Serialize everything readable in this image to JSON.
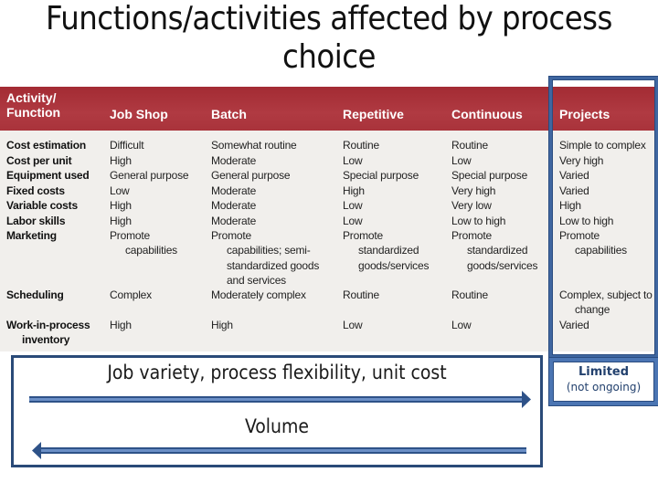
{
  "title": "Functions/activities affected by process choice",
  "table": {
    "headers": [
      "Activity/\nFunction",
      "Job Shop",
      "Batch",
      "Repetitive",
      "Continuous",
      "Projects"
    ],
    "rows": [
      {
        "label": "Cost estimation",
        "values": [
          "Difficult",
          "Somewhat routine",
          "Routine",
          "Routine",
          "Simple to complex"
        ]
      },
      {
        "label": "Cost per unit",
        "values": [
          "High",
          "Moderate",
          "Low",
          "Low",
          "Very high"
        ]
      },
      {
        "label": "Equipment used",
        "values": [
          "General purpose",
          "General purpose",
          "Special purpose",
          "Special purpose",
          "Varied"
        ]
      },
      {
        "label": "Fixed costs",
        "values": [
          "Low",
          "Moderate",
          "High",
          "Very high",
          "Varied"
        ]
      },
      {
        "label": "Variable costs",
        "values": [
          "High",
          "Moderate",
          "Low",
          "Very low",
          "High"
        ]
      },
      {
        "label": "Labor skills",
        "values": [
          "High",
          "Moderate",
          "Low",
          "Low to high",
          "Low to high"
        ]
      },
      {
        "label": "Marketing",
        "values": [
          "Promote\ncapabilities",
          "Promote\ncapabilities; semi-\nstandardized goods\nand services",
          "Promote\nstandardized\ngoods/services",
          "Promote\nstandardized\ngoods/services",
          "Promote\ncapabilities"
        ]
      },
      {
        "label": "Scheduling",
        "values": [
          "Complex",
          "Moderately complex",
          "Routine",
          "Routine",
          "Complex, subject to\nchange"
        ]
      },
      {
        "label": "Work-in-process\ninventory",
        "values": [
          "High",
          "High",
          "Low",
          "Low",
          "Varied"
        ]
      }
    ]
  },
  "callout": {
    "line1": "Limited",
    "line2": "(not ongoing)"
  },
  "bottom": {
    "top_label": "Job variety, process flexibility, unit cost",
    "top_arrow_direction": "right",
    "bottom_label": "Volume",
    "bottom_arrow_direction": "left"
  },
  "colors": {
    "header_red": "#a9313a",
    "accent_blue": "#3f66a0",
    "dark_blue": "#2a4a78"
  }
}
